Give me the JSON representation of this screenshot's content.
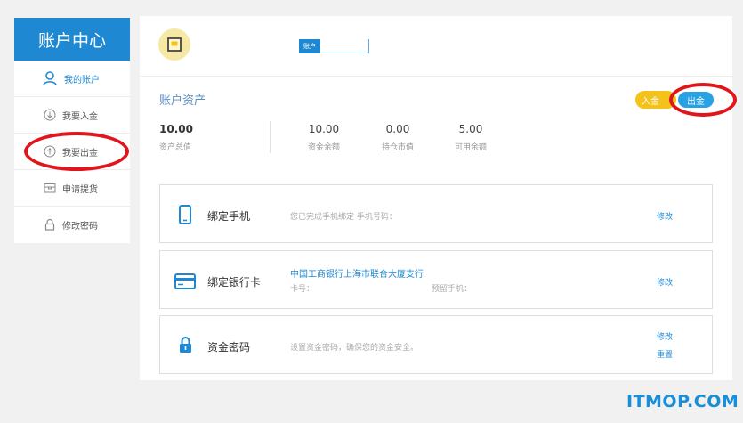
{
  "sidebar": {
    "title": "账户中心",
    "items": [
      {
        "label": "我的账户",
        "icon": "user-icon",
        "active": true
      },
      {
        "label": "我要入金",
        "icon": "arrow-down-circle-icon",
        "active": false
      },
      {
        "label": "我要出金",
        "icon": "arrow-up-circle-icon",
        "active": false
      },
      {
        "label": "申请提货",
        "icon": "box-icon",
        "active": false
      },
      {
        "label": "修改密码",
        "icon": "lock-icon",
        "active": false
      }
    ]
  },
  "header": {
    "account_tag": "账户"
  },
  "assets": {
    "title": "账户资产",
    "deposit_label": "入金",
    "withdraw_label": "出金",
    "total": {
      "value": "10.00",
      "label": "资产总值"
    },
    "stats": [
      {
        "value": "10.00",
        "label": "资金余额"
      },
      {
        "value": "0.00",
        "label": "持仓市值"
      },
      {
        "value": "5.00",
        "label": "可用余额"
      }
    ]
  },
  "cards": {
    "phone": {
      "title": "绑定手机",
      "desc": "您已完成手机绑定 手机号码：",
      "link": "修改"
    },
    "bank": {
      "title": "绑定银行卡",
      "bank_name": "中国工商银行上海市联合大厦支行",
      "card_no_label": "卡号：",
      "reserved_phone_label": "预留手机：",
      "link": "修改"
    },
    "fund_password": {
      "title": "资金密码",
      "desc": "设置资金密码，确保您的资金安全。",
      "link_modify": "修改",
      "link_reset": "重置"
    }
  },
  "watermark": "ITMOP.COM",
  "colors": {
    "primary": "#1e88d2",
    "deposit": "#f3c21b",
    "withdraw": "#28a2e5",
    "highlight_ring": "#e0161c"
  }
}
